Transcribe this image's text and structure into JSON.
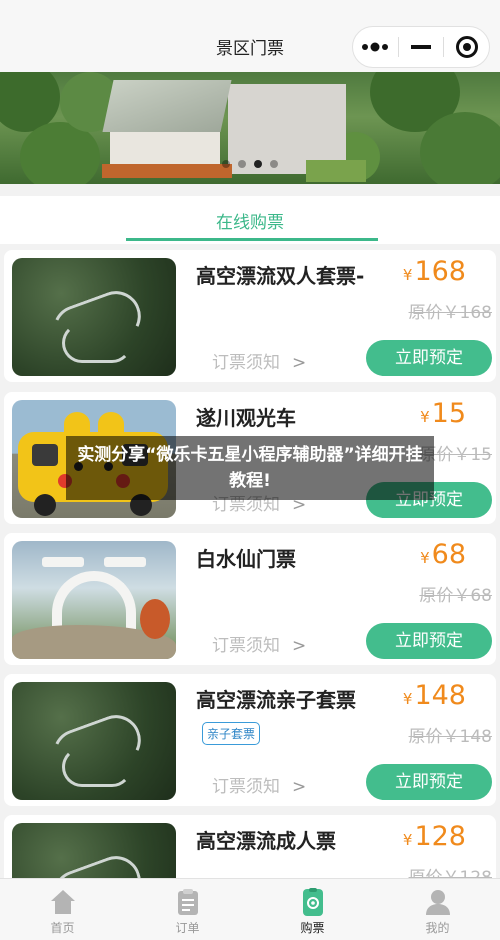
{
  "header": {
    "title": "景区门票",
    "capsule": {
      "more_icon": "more-dots-icon",
      "minimize_icon": "minimize-icon",
      "close_icon": "target-close-icon"
    }
  },
  "banner": {
    "slides": 4,
    "active_slide": 2
  },
  "tabs": [
    {
      "label": "在线购票",
      "active": true
    }
  ],
  "tickets": [
    {
      "title": "高空漂流双人套票-",
      "currency": "¥",
      "price": "168",
      "original_price": "原价￥168",
      "tag": "",
      "notice": "订票须知",
      "button": "立即预定"
    },
    {
      "title": "遂川观光车",
      "currency": "¥",
      "price": "15",
      "original_price": "原价￥15",
      "tag": "",
      "notice": "订票须知",
      "button": "立即预定"
    },
    {
      "title": "白水仙门票",
      "currency": "¥",
      "price": "68",
      "original_price": "原价￥68",
      "tag": "",
      "notice": "订票须知",
      "button": "立即预定"
    },
    {
      "title": "高空漂流亲子套票",
      "currency": "¥",
      "price": "148",
      "original_price": "原价￥148",
      "tag": "亲子套票",
      "notice": "订票须知",
      "button": "立即预定"
    },
    {
      "title": "高空漂流成人票",
      "currency": "¥",
      "price": "128",
      "original_price": "原价￥128",
      "tag": "",
      "notice": "",
      "button": ""
    }
  ],
  "overlay": {
    "text": "实测分享“微乐卡五星小程序辅助器”详细开挂教程!"
  },
  "bottom_nav": [
    {
      "label": "首页",
      "icon": "home-icon",
      "active": false
    },
    {
      "label": "订单",
      "icon": "clipboard-icon",
      "active": false
    },
    {
      "label": "购票",
      "icon": "ticket-icon",
      "active": true
    },
    {
      "label": "我的",
      "icon": "user-icon",
      "active": false
    }
  ],
  "colors": {
    "accent": "#43bd8d",
    "price": "#f08a1c",
    "tab_text": "#3cb88a",
    "tag": "#2f86c7"
  }
}
